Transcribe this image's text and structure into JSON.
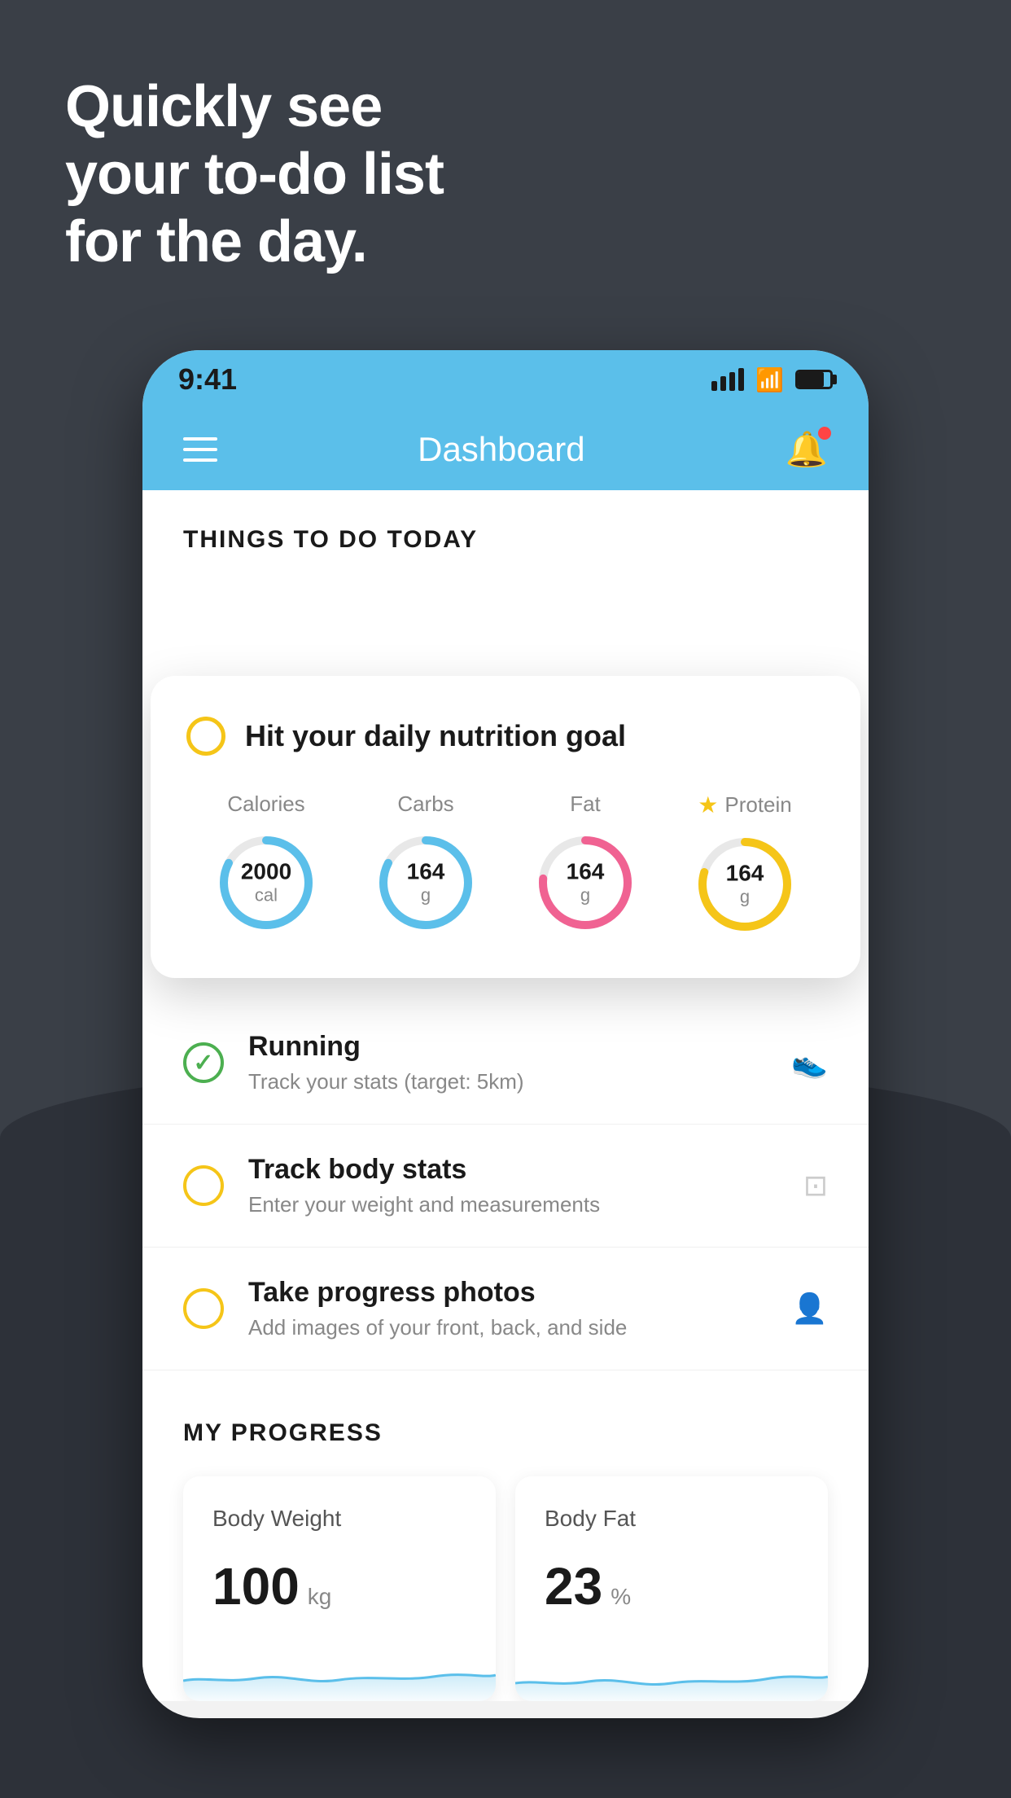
{
  "headline": {
    "line1": "Quickly see",
    "line2": "your to-do list",
    "line3": "for the day."
  },
  "status_bar": {
    "time": "9:41",
    "signal_bars": [
      0.4,
      0.6,
      0.8,
      1.0
    ]
  },
  "header": {
    "title": "Dashboard"
  },
  "things_section": {
    "label": "THINGS TO DO TODAY"
  },
  "nutrition_card": {
    "title": "Hit your daily nutrition goal",
    "macros": [
      {
        "label": "Calories",
        "value": "2000",
        "unit": "cal",
        "color": "blue",
        "star": false
      },
      {
        "label": "Carbs",
        "value": "164",
        "unit": "g",
        "color": "blue",
        "star": false
      },
      {
        "label": "Fat",
        "value": "164",
        "unit": "g",
        "color": "pink",
        "star": false
      },
      {
        "label": "Protein",
        "value": "164",
        "unit": "g",
        "color": "yellow",
        "star": true
      }
    ]
  },
  "todo_items": [
    {
      "title": "Running",
      "subtitle": "Track your stats (target: 5km)",
      "status": "green",
      "icon": "shoe"
    },
    {
      "title": "Track body stats",
      "subtitle": "Enter your weight and measurements",
      "status": "yellow",
      "icon": "scale"
    },
    {
      "title": "Take progress photos",
      "subtitle": "Add images of your front, back, and side",
      "status": "yellow",
      "icon": "person"
    }
  ],
  "progress_section": {
    "title": "MY PROGRESS",
    "cards": [
      {
        "title": "Body Weight",
        "value": "100",
        "unit": "kg"
      },
      {
        "title": "Body Fat",
        "value": "23",
        "unit": "%"
      }
    ]
  }
}
